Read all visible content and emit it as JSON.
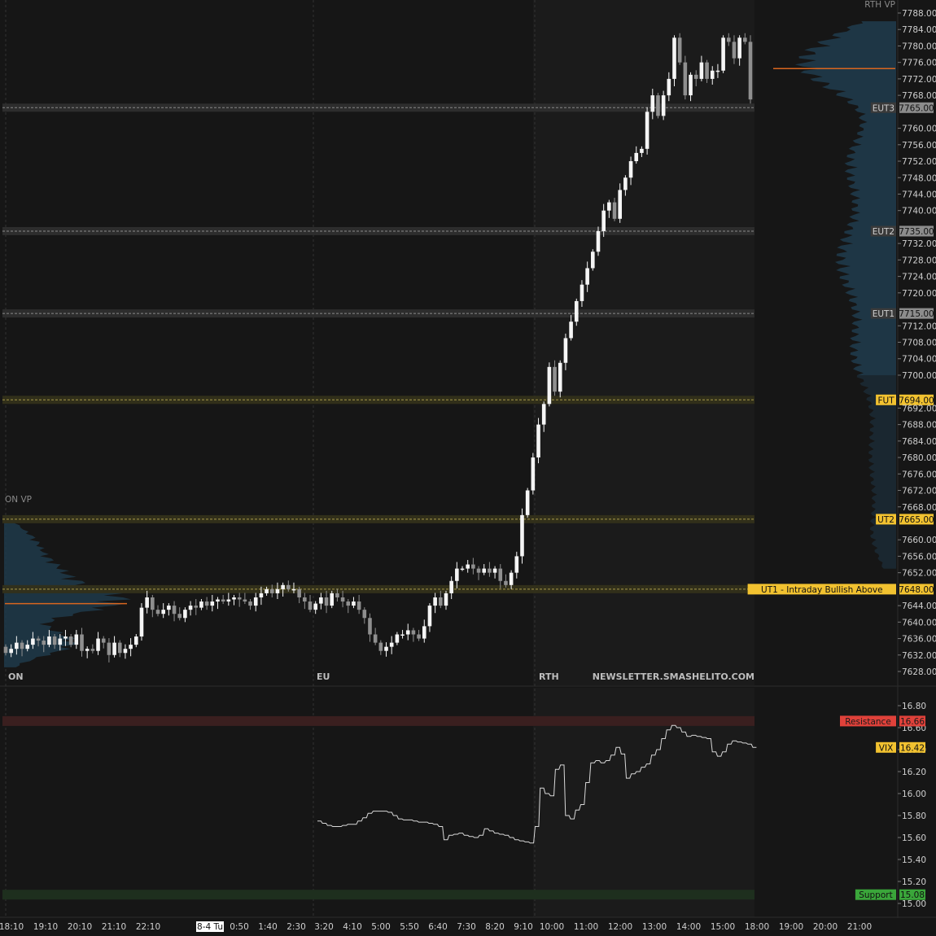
{
  "chart_data": [
    {
      "type": "candlestick",
      "title": "",
      "y_ticks": [
        7788,
        7784,
        7780,
        7776,
        7772,
        7768,
        7760,
        7756,
        7752,
        7748,
        7744,
        7740,
        7732,
        7728,
        7724,
        7720,
        7712,
        7708,
        7704,
        7700,
        7692,
        7688,
        7684,
        7680,
        7676,
        7672,
        7668,
        7660,
        7656,
        7652,
        7644,
        7640,
        7636,
        7632,
        7628
      ],
      "ylim": [
        7628,
        7788
      ],
      "x_tick_labels": [
        "18:10",
        "19:10",
        "20:10",
        "21:10",
        "22:10",
        "8-4 Tu",
        "0:50",
        "1:40",
        "2:30",
        "3:20",
        "4:10",
        "5:00",
        "5:50",
        "6:40",
        "7:30",
        "8:20",
        "9:10",
        "10:00",
        "11:00",
        "12:00",
        "13:00",
        "14:00",
        "15:00",
        "18:00",
        "19:00",
        "20:00",
        "21:00"
      ],
      "sessions": [
        "ON",
        "EU",
        "RTH"
      ],
      "watermark": "NEWSLETTER.SMASHELITO.COM",
      "profiles": [
        "ON VP",
        "RTH VP"
      ],
      "levels": [
        {
          "label": "EUT3",
          "price": 7765.0,
          "value_text": "7765.00",
          "kind": "gray"
        },
        {
          "label": "EUT2",
          "price": 7735.0,
          "value_text": "7735.00",
          "kind": "gray"
        },
        {
          "label": "EUT1",
          "price": 7715.0,
          "value_text": "7715.00",
          "kind": "gray"
        },
        {
          "label": "FUT",
          "price": 7694.0,
          "value_text": "7694.00",
          "kind": "yellow"
        },
        {
          "label": "UT2",
          "price": 7665.0,
          "value_text": "7665.00",
          "kind": "yellow"
        },
        {
          "label": "UT1 - Intraday Bullish Above",
          "price": 7648.0,
          "value_text": "7648.00",
          "kind": "yellow"
        }
      ],
      "poc": {
        "on": 7644.5,
        "rth": 7774.5
      },
      "closes": [
        7632.5,
        7633.5,
        7635,
        7633.5,
        7634.5,
        7636,
        7635.5,
        7634.5,
        7636.5,
        7634.5,
        7636,
        7636.5,
        7634.5,
        7637,
        7633,
        7633.5,
        7633,
        7636,
        7635,
        7632,
        7635,
        7632.5,
        7633.5,
        7634.5,
        7636.5,
        7643.5,
        7646,
        7643,
        7642,
        7643,
        7644,
        7642,
        7641,
        7643,
        7644,
        7643.5,
        7645,
        7644,
        7645,
        7645.5,
        7645,
        7645.5,
        7646,
        7645.5,
        7645,
        7644,
        7646,
        7647,
        7648,
        7647,
        7648,
        7649,
        7648,
        7648,
        7646,
        7645,
        7643,
        7644.5,
        7646,
        7644,
        7647,
        7646,
        7645,
        7644,
        7645,
        7643,
        7641,
        7637,
        7635,
        7633,
        7634,
        7635,
        7637,
        7637,
        7638,
        7637,
        7636,
        7639,
        7644,
        7646,
        7644,
        7647,
        7650,
        7653,
        7653,
        7654,
        7653,
        7652,
        7653,
        7652,
        7653,
        7650,
        7649,
        7652,
        7656,
        7666,
        7672,
        7680,
        7688,
        7693,
        7702,
        7696,
        7703,
        7709,
        7713,
        7718,
        7722,
        7726,
        7730,
        7735,
        7740,
        7742,
        7738,
        7745,
        7748,
        7752,
        7754,
        7755,
        7764,
        7768,
        7763,
        7768,
        7772,
        7782,
        7776,
        7768,
        7773,
        7772,
        7776,
        7772,
        7774,
        7774,
        7782,
        7781,
        7777,
        7782,
        7781,
        7767
      ],
      "vix": {
        "y_ticks": [
          16.8,
          16.6,
          16.4,
          16.2,
          16.0,
          15.8,
          15.6,
          15.4,
          15.2,
          15.0
        ],
        "ylim": [
          14.95,
          16.88
        ],
        "resistance": {
          "label": "Resistance",
          "value": 16.66,
          "value_text": "16.66"
        },
        "support": {
          "label": "Support",
          "value": 15.08,
          "value_text": "15.08"
        },
        "last": {
          "label": "VIX",
          "value": 16.42,
          "value_text": "16.42"
        },
        "values": [
          15.75,
          15.73,
          15.71,
          15.7,
          15.7,
          15.71,
          15.72,
          15.72,
          15.75,
          15.78,
          15.82,
          15.84,
          15.84,
          15.84,
          15.83,
          15.8,
          15.77,
          15.76,
          15.76,
          15.75,
          15.74,
          15.74,
          15.73,
          15.72,
          15.7,
          15.58,
          15.62,
          15.63,
          15.64,
          15.62,
          15.61,
          15.6,
          15.62,
          15.68,
          15.66,
          15.64,
          15.63,
          15.62,
          15.6,
          15.58,
          15.57,
          15.56,
          15.55,
          15.7,
          16.05,
          16.0,
          15.98,
          16.22,
          16.26,
          15.8,
          15.77,
          15.85,
          15.9,
          16.1,
          16.28,
          16.3,
          16.28,
          16.3,
          16.35,
          16.42,
          16.36,
          16.14,
          16.18,
          16.2,
          16.24,
          16.27,
          16.35,
          16.4,
          16.5,
          16.58,
          16.62,
          16.6,
          16.56,
          16.52,
          16.53,
          16.52,
          16.51,
          16.5,
          16.38,
          16.34,
          16.38,
          16.45,
          16.48,
          16.47,
          16.46,
          16.45,
          16.42
        ]
      }
    }
  ]
}
